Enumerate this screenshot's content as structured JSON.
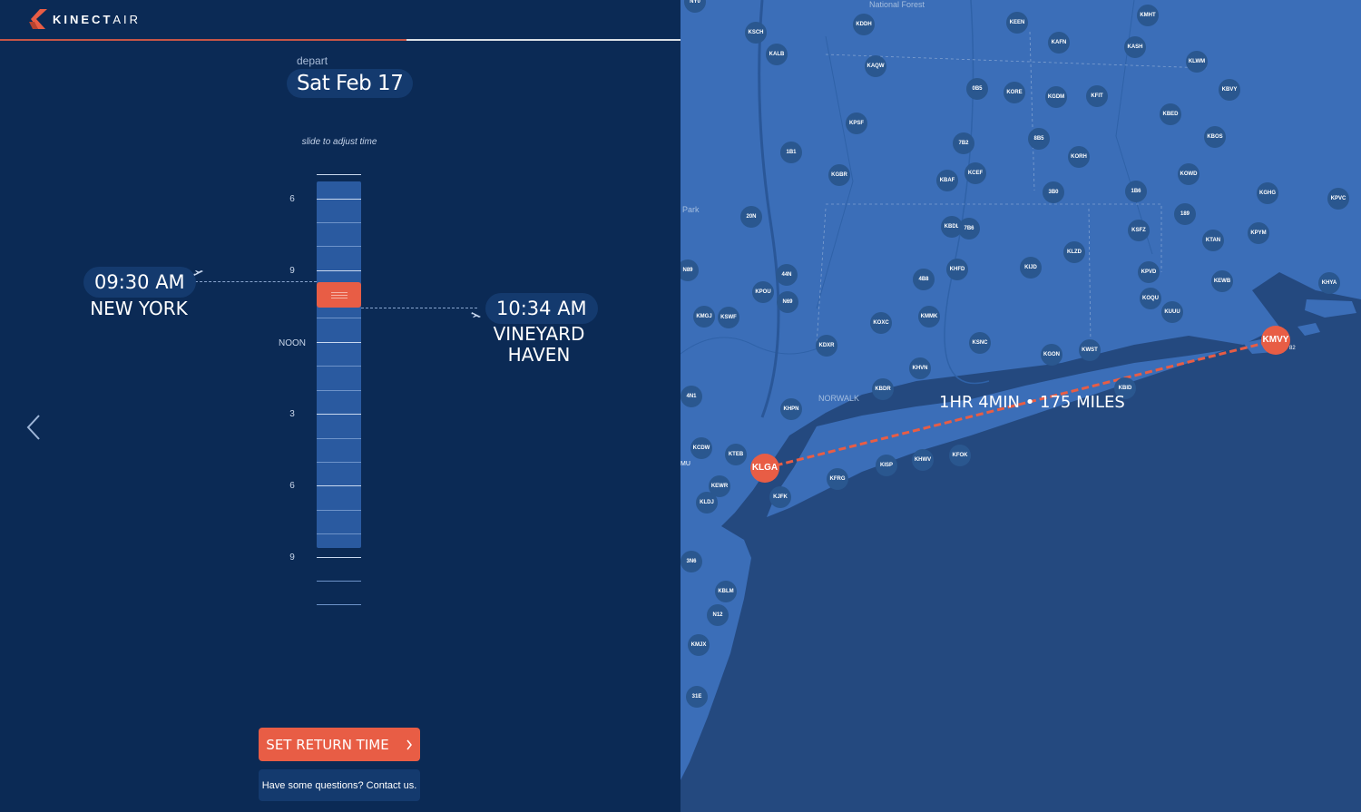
{
  "brand": {
    "name_bold": "KINECT",
    "name_light": "AIR",
    "accent": "#e85d45"
  },
  "depart": {
    "label": "depart",
    "date": "Sat Feb 17"
  },
  "slider": {
    "hint": "slide to adjust time",
    "hour_labels": [
      "6",
      "9",
      "NOON",
      "3",
      "6",
      "9"
    ]
  },
  "origin": {
    "time": "09:30  AM",
    "city": "NEW YORK"
  },
  "destination": {
    "time": "10:34  AM",
    "city_line1": "VINEYARD",
    "city_line2": "HAVEN"
  },
  "actions": {
    "set_return": "SET RETURN TIME",
    "questions": "Have some questions? Contact us."
  },
  "map": {
    "flight_info": "1HR 4MIN • 175 MILES",
    "origin_code": "KLGA",
    "destination_code": "KMVY",
    "place_labels": [
      "NORWALK",
      "Park",
      "National Forest",
      "MU",
      "82"
    ],
    "airports": [
      "NY0",
      "KSCH",
      "KDDH",
      "KEEN",
      "KMHT",
      "KAFN",
      "KASH",
      "KALB",
      "KAQW",
      "KLWM",
      "0B5",
      "KORE",
      "KGDM",
      "KFIT",
      "KBVY",
      "KBED",
      "KPSF",
      "7B2",
      "8B5",
      "KBOS",
      "1B1",
      "KORH",
      "KOWD",
      "KGBR",
      "KCEF",
      "KBAF",
      "3B0",
      "1B6",
      "KGHG",
      "KPVC",
      "20N",
      "189",
      "KBDL",
      "7B6",
      "KSFZ",
      "KTAN",
      "KPYM",
      "KLZD",
      "N89",
      "44N",
      "KHFD",
      "KIJD",
      "KPVD",
      "4B8",
      "KEWB",
      "KHYA",
      "KPOU",
      "N69",
      "KOQU",
      "KUUU",
      "KMGJ",
      "KSWF",
      "KOXC",
      "KMMK",
      "KDXR",
      "KSNC",
      "KGON",
      "KWST",
      "KHVN",
      "KBDR",
      "KBID",
      "4N1",
      "KHPN",
      "KCDW",
      "KTEB",
      "KEWR",
      "KFRG",
      "KISP",
      "KHWV",
      "KFOK",
      "KLDJ",
      "KJFK",
      "3N6",
      "KBLM",
      "N12",
      "KMJX",
      "31E"
    ]
  }
}
